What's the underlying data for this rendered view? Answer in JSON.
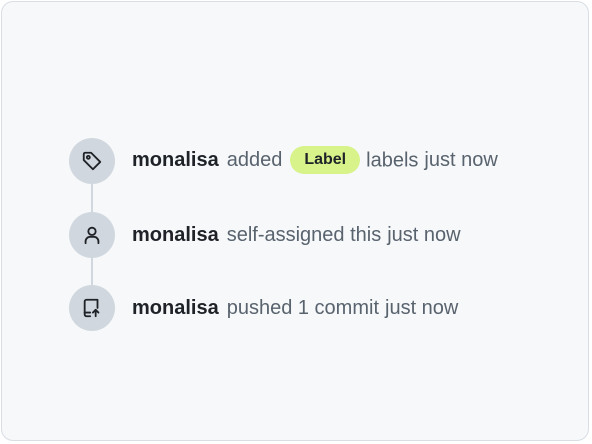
{
  "events": [
    {
      "icon": "tag-icon",
      "author": "monalisa",
      "action": "added",
      "label": {
        "text": "Label",
        "color": "#d8f38a"
      },
      "tail": "labels",
      "time": "just now"
    },
    {
      "icon": "person-icon",
      "author": "monalisa",
      "action": "self-assigned this",
      "time": "just now"
    },
    {
      "icon": "repo-push-icon",
      "author": "monalisa",
      "action": "pushed 1 commit",
      "time": "just now"
    }
  ],
  "colors": {
    "background": "#f6f8fa",
    "badge": "#d0d7de",
    "author_text": "#1f2328",
    "muted_text": "#59636e",
    "label_bg": "#d8f38a"
  }
}
